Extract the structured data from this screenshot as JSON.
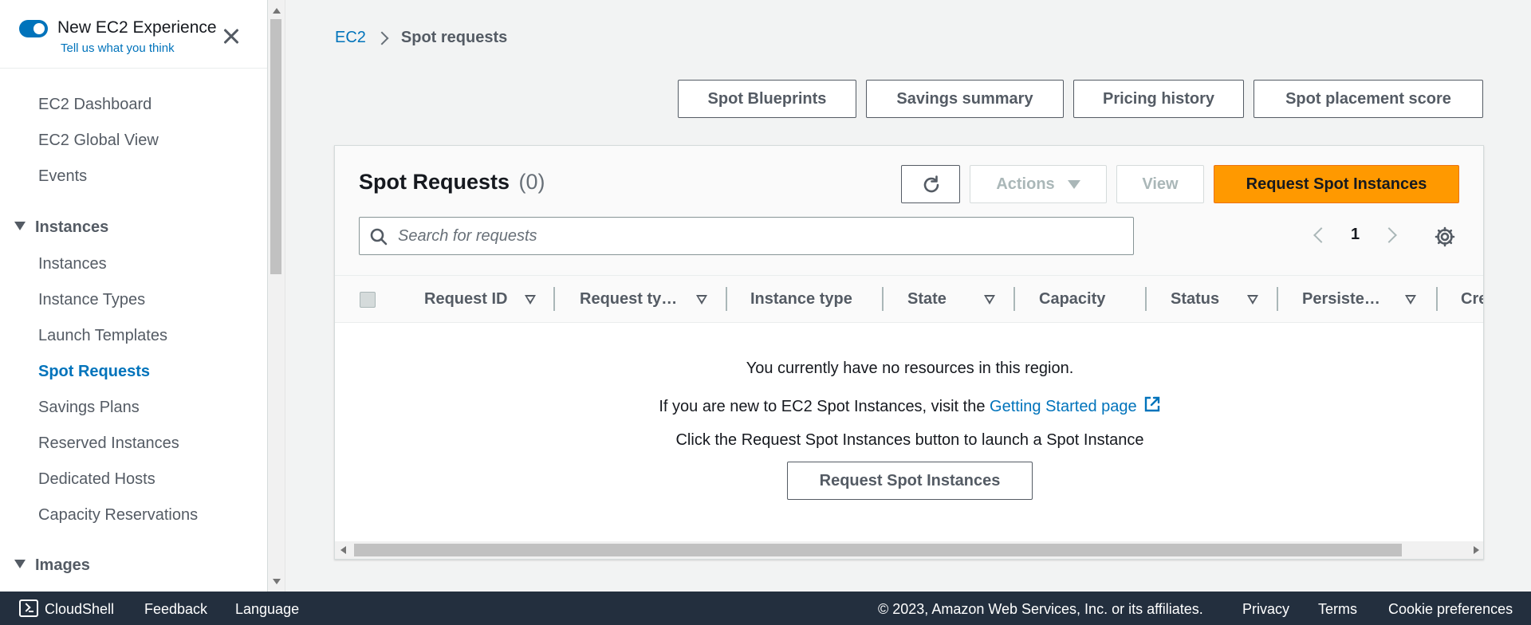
{
  "sidebar": {
    "experience_title": "New EC2 Experience",
    "experience_link": "Tell us what you think",
    "items": [
      {
        "label": "EC2 Dashboard"
      },
      {
        "label": "EC2 Global View"
      },
      {
        "label": "Events"
      }
    ],
    "instances_section": "Instances",
    "instances_items": [
      {
        "label": "Instances"
      },
      {
        "label": "Instance Types"
      },
      {
        "label": "Launch Templates"
      },
      {
        "label": "Spot Requests",
        "active": true
      },
      {
        "label": "Savings Plans"
      },
      {
        "label": "Reserved Instances"
      },
      {
        "label": "Dedicated Hosts"
      },
      {
        "label": "Capacity Reservations"
      }
    ],
    "images_section": "Images"
  },
  "breadcrumb": {
    "root": "EC2",
    "current": "Spot requests"
  },
  "top_buttons": {
    "blueprints": "Spot Blueprints",
    "savings": "Savings summary",
    "pricing": "Pricing history",
    "placement": "Spot placement score"
  },
  "panel": {
    "title": "Spot Requests",
    "count": "(0)",
    "actions_label": "Actions",
    "view_label": "View",
    "primary_label": "Request Spot Instances",
    "search_placeholder": "Search for requests",
    "page_number": "1"
  },
  "table": {
    "columns": [
      "Request ID",
      "Request ty…",
      "Instance type",
      "State",
      "Capacity",
      "Status",
      "Persiste…",
      "Cre"
    ]
  },
  "empty_state": {
    "line1": "You currently have no resources in this region.",
    "line2_prefix": "If you are new to EC2 Spot Instances, visit the",
    "line2_link": "Getting Started page",
    "line3": "Click the Request Spot Instances button to launch a Spot Instance",
    "button": "Request Spot Instances"
  },
  "footer": {
    "cloudshell": "CloudShell",
    "feedback": "Feedback",
    "language": "Language",
    "copyright": "© 2023, Amazon Web Services, Inc. or its affiliates.",
    "privacy": "Privacy",
    "terms": "Terms",
    "cookies": "Cookie preferences"
  },
  "colors": {
    "accent": "#0073bb",
    "primary_button": "#ff9900",
    "footer_bg": "#232f3e"
  }
}
